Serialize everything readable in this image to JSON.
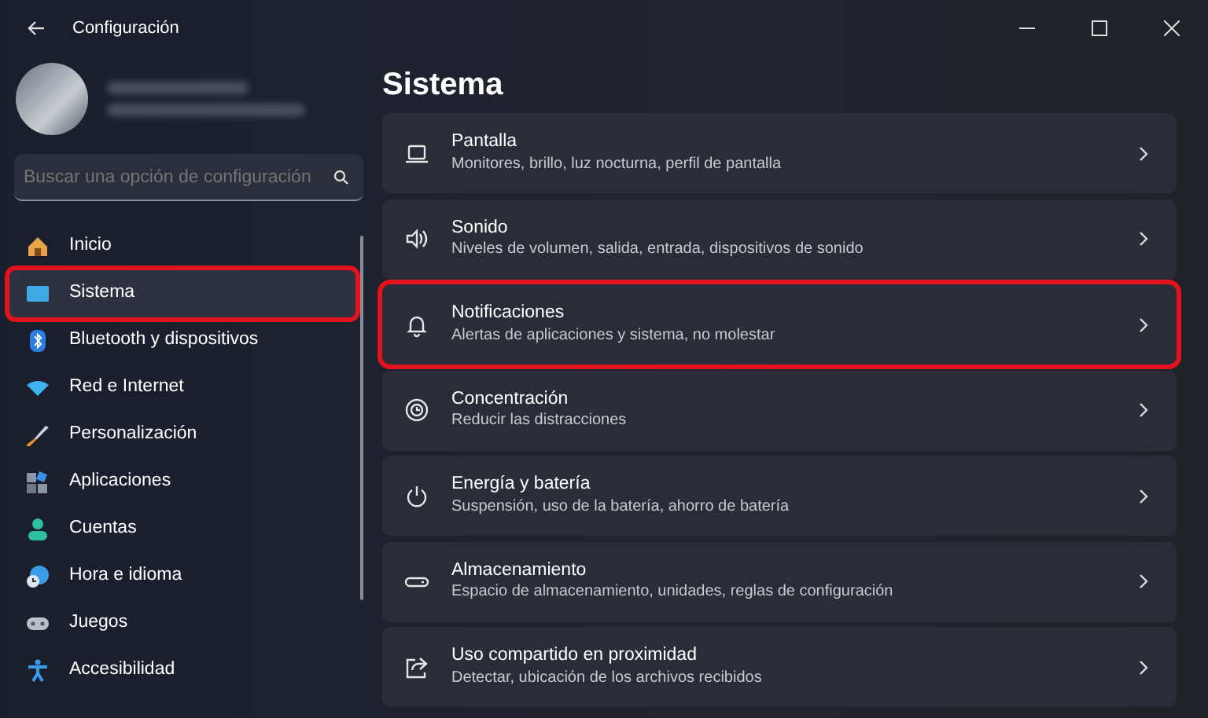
{
  "window": {
    "title": "Configuración"
  },
  "search": {
    "placeholder": "Buscar una opción de configuración"
  },
  "sidebar": {
    "items": [
      {
        "label": "Inicio",
        "selected": false,
        "highlighted": false
      },
      {
        "label": "Sistema",
        "selected": true,
        "highlighted": true
      },
      {
        "label": "Bluetooth y dispositivos",
        "selected": false,
        "highlighted": false
      },
      {
        "label": "Red e Internet",
        "selected": false,
        "highlighted": false
      },
      {
        "label": "Personalización",
        "selected": false,
        "highlighted": false
      },
      {
        "label": "Aplicaciones",
        "selected": false,
        "highlighted": false
      },
      {
        "label": "Cuentas",
        "selected": false,
        "highlighted": false
      },
      {
        "label": "Hora e idioma",
        "selected": false,
        "highlighted": false
      },
      {
        "label": "Juegos",
        "selected": false,
        "highlighted": false
      },
      {
        "label": "Accesibilidad",
        "selected": false,
        "highlighted": false
      }
    ]
  },
  "page": {
    "title": "Sistema",
    "items": [
      {
        "title": "Pantalla",
        "description": "Monitores, brillo, luz nocturna, perfil de pantalla",
        "highlighted": false
      },
      {
        "title": "Sonido",
        "description": "Niveles de volumen, salida, entrada, dispositivos de sonido",
        "highlighted": false
      },
      {
        "title": "Notificaciones",
        "description": "Alertas de aplicaciones y sistema, no molestar",
        "highlighted": true
      },
      {
        "title": "Concentración",
        "description": "Reducir las distracciones",
        "highlighted": false
      },
      {
        "title": "Energía y batería",
        "description": "Suspensión, uso de la batería, ahorro de batería",
        "highlighted": false
      },
      {
        "title": "Almacenamiento",
        "description": "Espacio de almacenamiento, unidades, reglas de configuración",
        "highlighted": false
      },
      {
        "title": "Uso compartido en proximidad",
        "description": "Detectar, ubicación de los archivos recibidos",
        "highlighted": false
      }
    ]
  }
}
